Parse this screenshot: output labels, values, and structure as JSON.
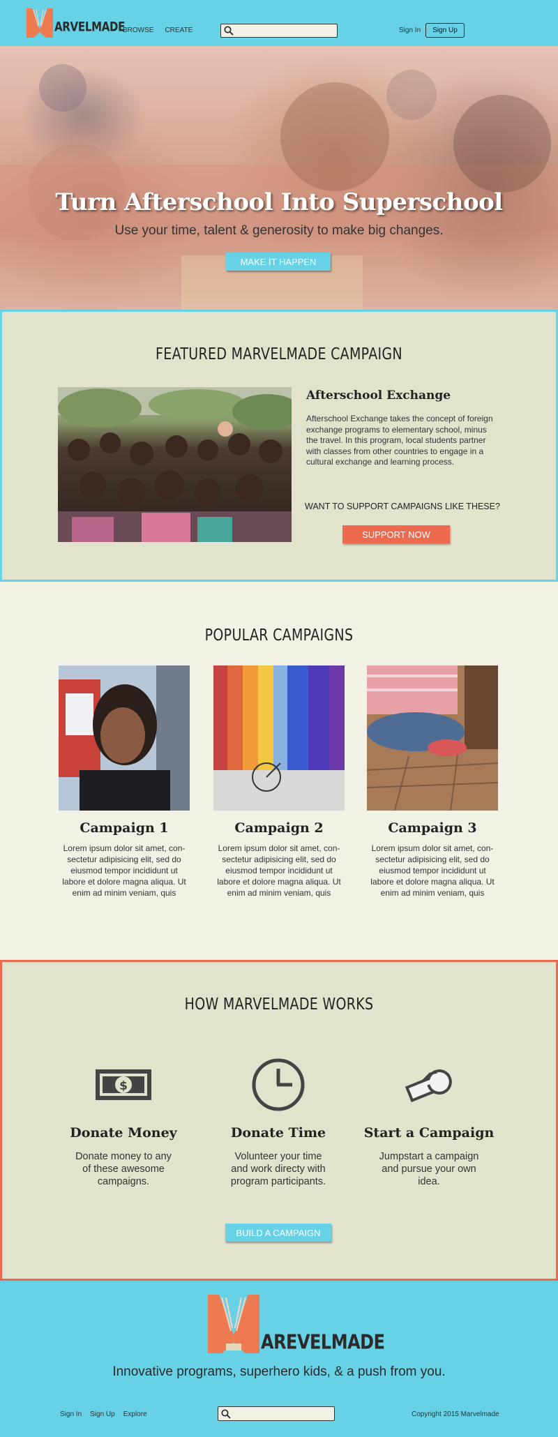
{
  "header": {
    "brand": "ARVELMADE",
    "nav": [
      "BROWSE",
      "CREATE"
    ],
    "search_placeholder": "",
    "signin": "Sign In",
    "signup": "Sign Up"
  },
  "hero": {
    "title": "Turn Afterschool Into Superschool",
    "subtitle": "Use your time, talent & generosity to make big changes.",
    "cta": "MAKE IT HAPPEN"
  },
  "featured": {
    "heading": "FEATURED MARVELMADE CAMPAIGN",
    "title": "Afterschool Exchange",
    "description": "Afterschool Exchange takes the concept of foreign exchange programs to elementary school, minus the travel. In this program, local students partner with classes from other countries to engage in a cultural exchange and learning process.",
    "question": "WANT TO SUPPORT CAMPAIGNS LIKE THESE?",
    "cta": "SUPPORT NOW"
  },
  "popular": {
    "heading": "POPULAR CAMPAIGNS",
    "campaigns": [
      {
        "title": "Campaign 1",
        "text": "Lorem ipsum dolor sit amet, con-sectetur adipisicing elit, sed do eiusmod tempor incididunt ut labore et dolore magna aliqua. Ut enim ad minim veniam, quis"
      },
      {
        "title": "Campaign 2",
        "text": "Lorem ipsum dolor sit amet, con-sectetur adipisicing elit, sed do eiusmod tempor incididunt ut labore et dolore magna aliqua. Ut enim ad minim veniam, quis"
      },
      {
        "title": "Campaign 3",
        "text": "Lorem ipsum dolor sit amet, con-sectetur adipisicing elit, sed do eiusmod tempor incididunt ut labore et dolore magna aliqua. Ut enim ad minim veniam, quis"
      }
    ]
  },
  "how": {
    "heading": "HOW MARVELMADE WORKS",
    "items": [
      {
        "icon": "money-icon",
        "title": "Donate Money",
        "text": "Donate money to any of these awesome campaigns."
      },
      {
        "icon": "clock-icon",
        "title": "Donate Time",
        "text": "Volunteer your time and work directy with program participants."
      },
      {
        "icon": "whistle-icon",
        "title": "Start a Campaign",
        "text": "Jumpstart a campaign and pursue your own idea."
      }
    ],
    "cta": "BUILD A CAMPAIGN"
  },
  "footer": {
    "brand": "AREVELMADE",
    "tagline": "Innovative programs, superhero kids, & a push from you.",
    "links": [
      "Sign In",
      "Sign Up",
      "Explore"
    ],
    "search_placeholder": "",
    "copyright": "Copyright 2015 Marvelmade"
  },
  "colors": {
    "primary_blue": "#67d1e6",
    "accent_orange": "#ee6a4f",
    "section_bg": "#e2e3cc",
    "page_bg": "#f1f1e6"
  }
}
